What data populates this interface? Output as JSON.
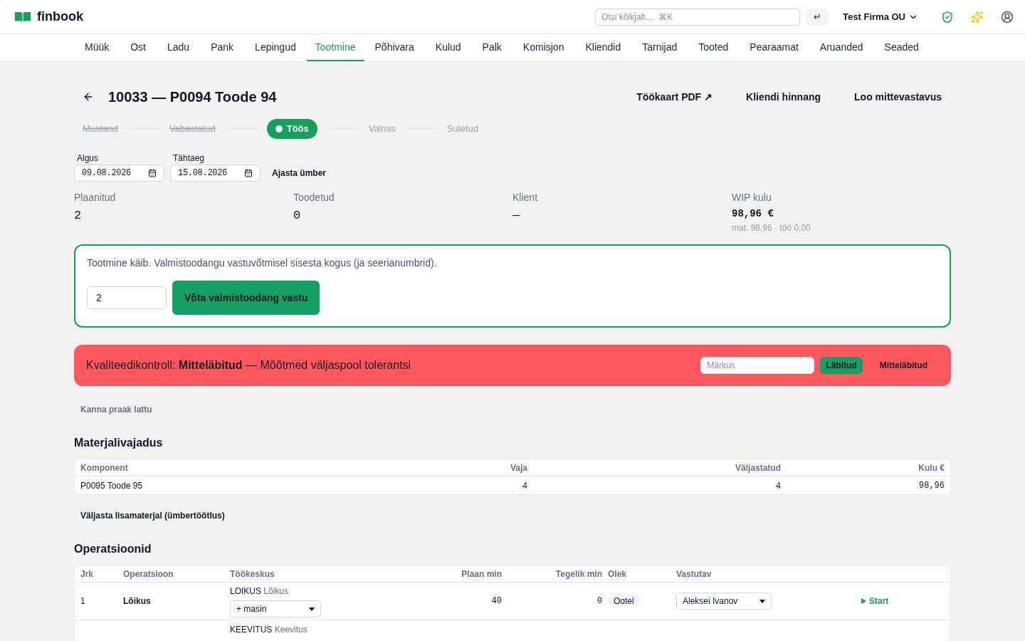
{
  "header": {
    "logo": "finbook",
    "search": {
      "placeholder": "Otsi kõikjalt…  ⌘K"
    },
    "enter_key": "↵",
    "company": "Test Firma OU"
  },
  "nav": [
    {
      "label": "Müük",
      "selected": false
    },
    {
      "label": "Ost",
      "selected": false
    },
    {
      "label": "Ladu",
      "selected": false
    },
    {
      "label": "Pank",
      "selected": false
    },
    {
      "label": "Lepingud",
      "selected": false
    },
    {
      "label": "Tootmine",
      "selected": true
    },
    {
      "label": "Põhivara",
      "selected": false
    },
    {
      "label": "Kulud",
      "selected": false
    },
    {
      "label": "Palk",
      "selected": false
    },
    {
      "label": "Komisjon",
      "selected": false
    },
    {
      "label": "Kliendid",
      "selected": false
    },
    {
      "label": "Tarnijad",
      "selected": false
    },
    {
      "label": "Tooted",
      "selected": false
    },
    {
      "label": "Pearaamat",
      "selected": false
    },
    {
      "label": "Aruanded",
      "selected": false
    },
    {
      "label": "Seaded",
      "selected": false
    }
  ],
  "title": "10033 — P0094 Toode 94",
  "actions": [
    "Töökaart PDF ↗",
    "Kliendi hinnang",
    "Loo mittevastavus"
  ],
  "steps": [
    {
      "label": "Mustand",
      "struck": true,
      "selected": false
    },
    {
      "label": "Vabastatud",
      "struck": true,
      "selected": false
    },
    {
      "label": "Töös",
      "struck": false,
      "selected": true
    },
    {
      "label": "Valmis",
      "struck": false,
      "selected": false
    },
    {
      "label": "Suletud",
      "struck": false,
      "selected": false
    }
  ],
  "dates": [
    {
      "label": "Algus",
      "value": "09.08.2026"
    },
    {
      "label": "Tähtaeg",
      "value": "15.08.2026"
    }
  ],
  "reschedule": "Ajasta ümber",
  "stats": [
    {
      "label": "Plaanitud",
      "value": "2"
    },
    {
      "label": "Toodetud",
      "value": "0"
    },
    {
      "label": "Klient",
      "value": "—"
    },
    {
      "label": "WIP kulu",
      "value": "98,96 €",
      "note": "mat. 98,96 · töö 0,00"
    }
  ],
  "receive": {
    "message": "Tootmine käib. Valmistoodangu vastuvõtmisel sisesta kogus (ja seerianumbrid).",
    "quantity": "2",
    "button": "Võta valmistoodang vastu"
  },
  "quality": {
    "text": "Kvaliteedikontroll: **Mitteläbitud** — Mõõtmed väljaspool tolerantsi",
    "note_placeholder": "Märkus",
    "pass": "Läbitud",
    "fail": "Mitteläbitud"
  },
  "scrap_button": "Kanna praak lattu",
  "materials": {
    "title": "Materjalivajadus",
    "columns": [
      "Komponent",
      "Vaja",
      "Väljastatud",
      "Kulu €"
    ],
    "rows": [
      [
        "P0095 Toode 95",
        "4",
        "4",
        "98,96"
      ]
    ],
    "extra_button": "Väljasta lisamaterjal (ümbertöötlus)"
  },
  "operations": {
    "title": "Operatsioonid",
    "columns": [
      "Jrk",
      "Operatsioon",
      "Töökeskus",
      "Plaan min",
      "Tegelik min",
      "Olek",
      "Vastutav"
    ],
    "rows": [
      {
        "seq": "1",
        "name": "Lõikus",
        "center_code": "LOIKUS",
        "center_name": "Lõikus",
        "machine": "+ masin",
        "plan": "40",
        "actual": "0",
        "status": "Ootel",
        "owner": "Aleksei Ivanov",
        "action": "Start"
      },
      {
        "center_code": "KEEVITUS",
        "center_name": "Keevitus"
      }
    ]
  }
}
